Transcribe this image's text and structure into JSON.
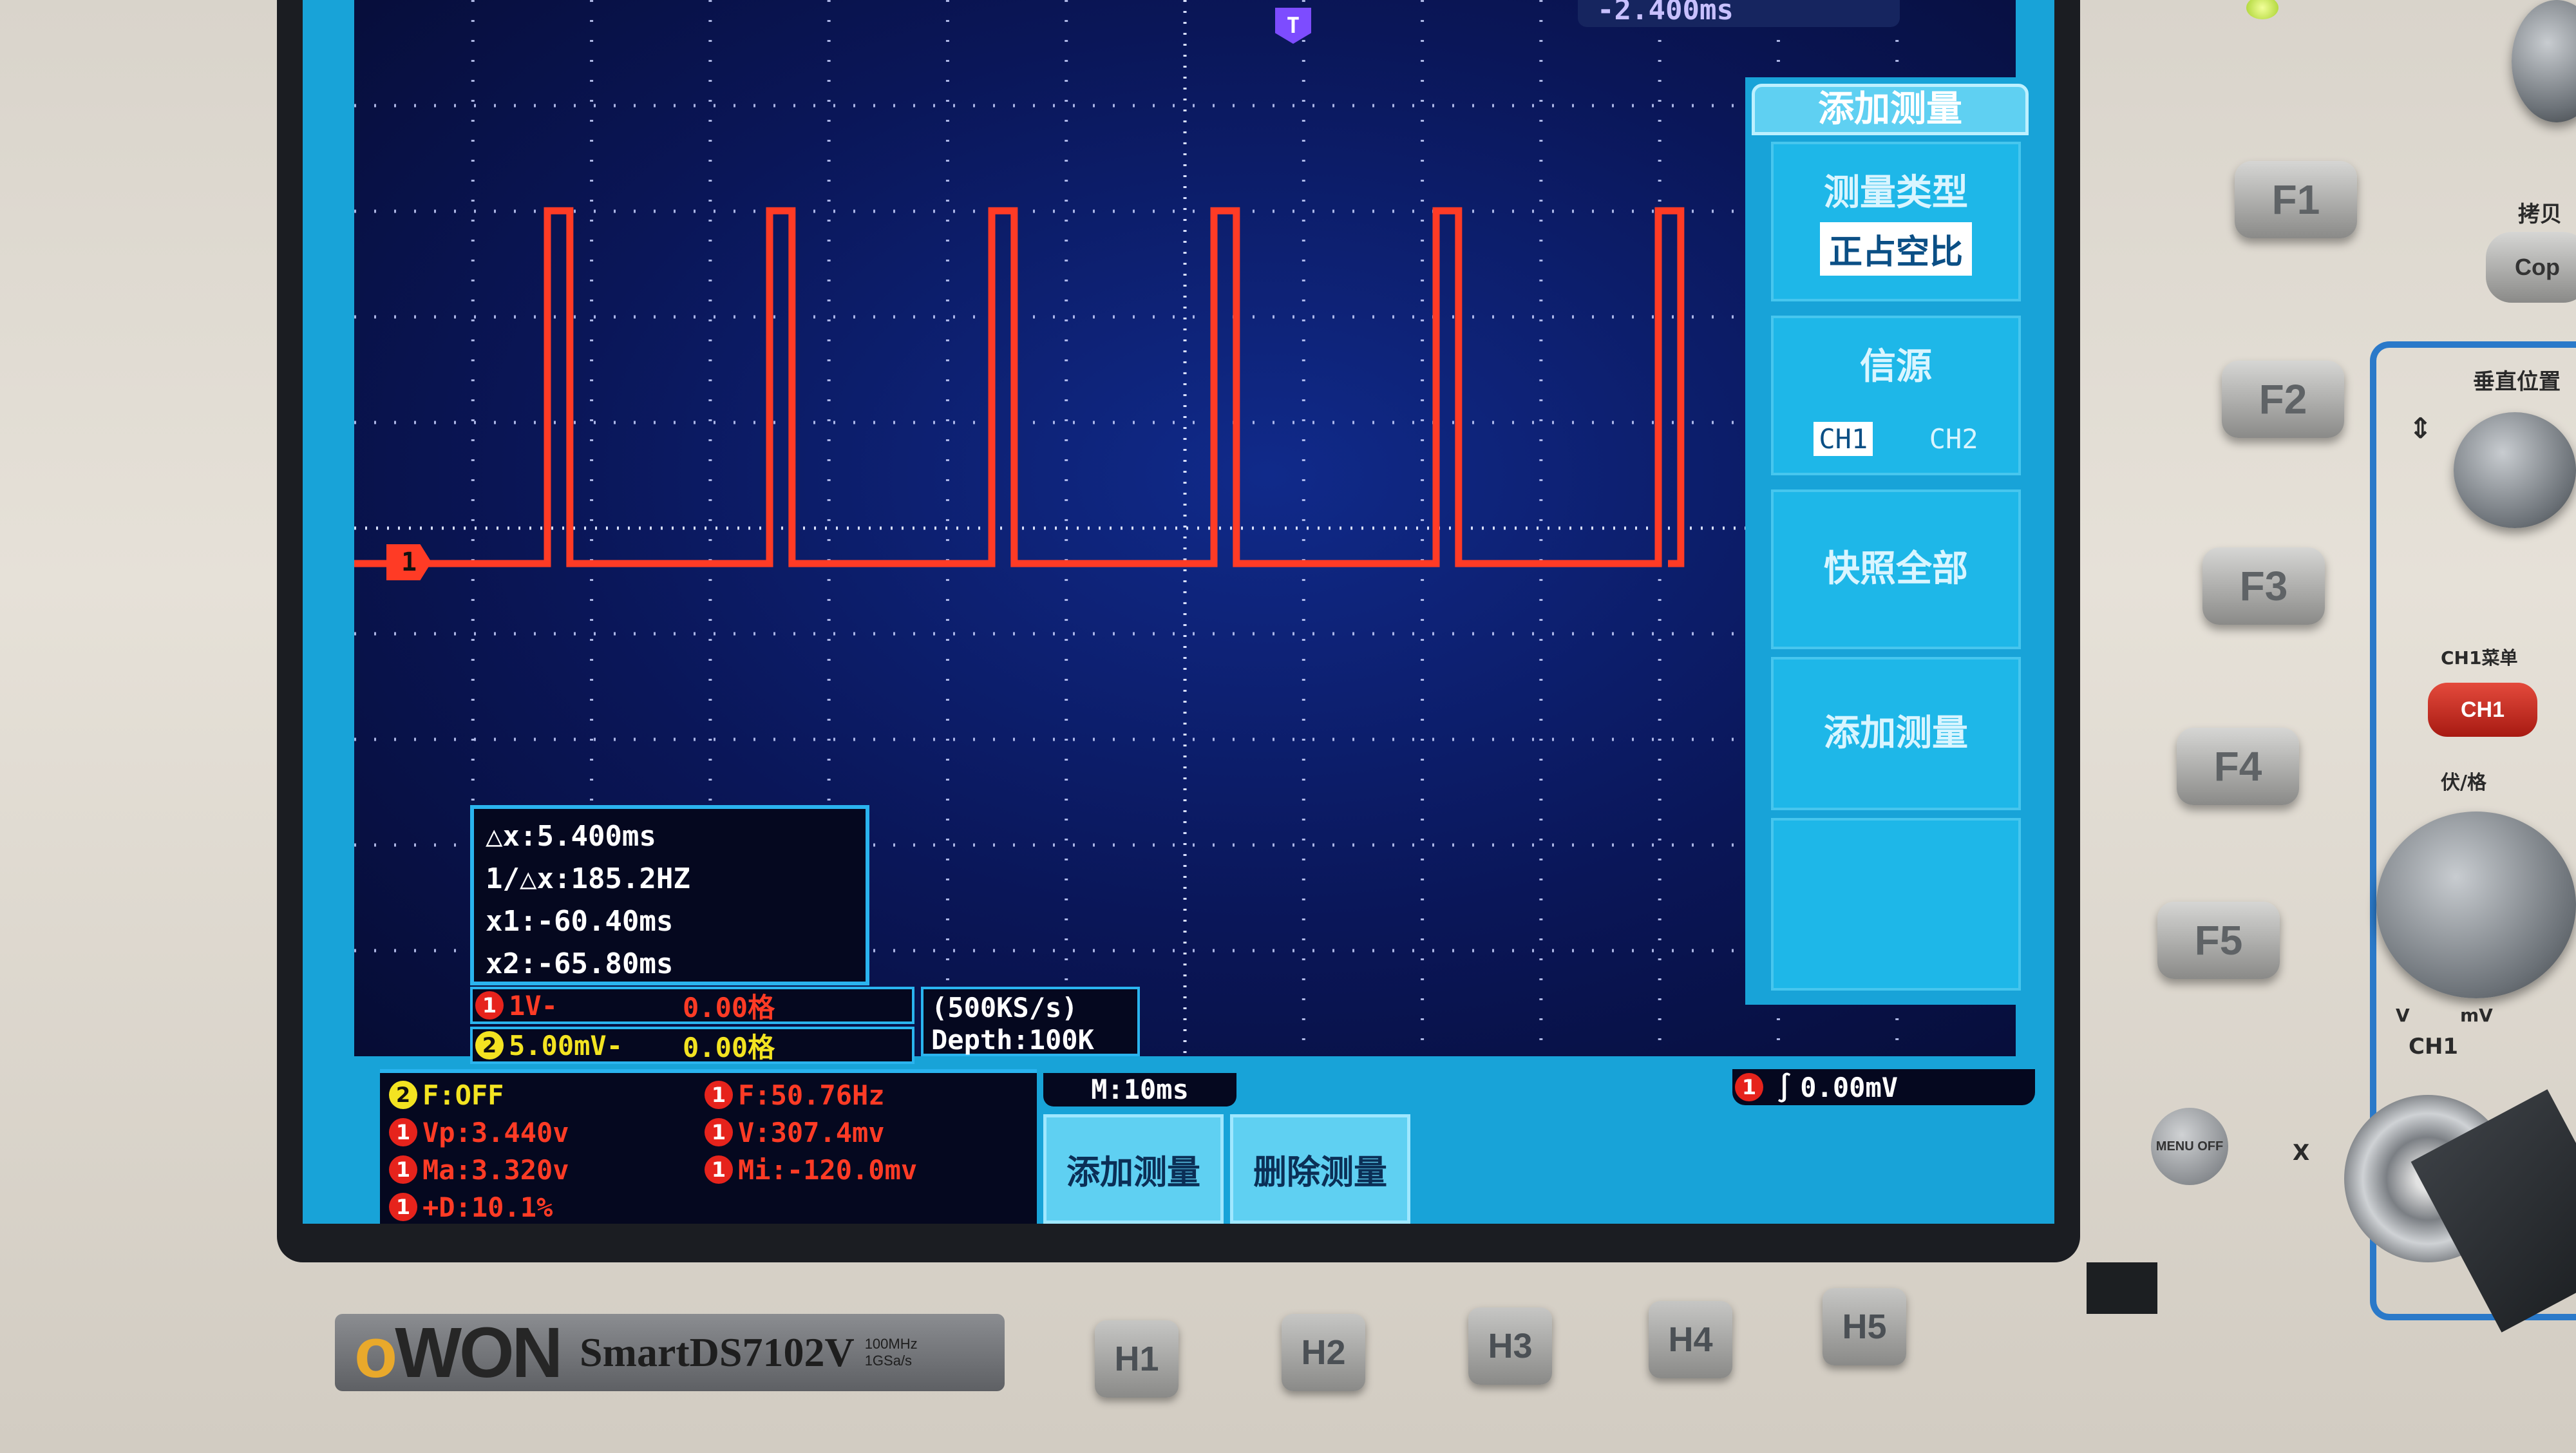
{
  "top_readout": "-2.400ms",
  "t_marker": "T",
  "ch1_marker": "1",
  "cursor": {
    "dx": "△x:5.400ms",
    "inv_dx": "1/△x:185.2HZ",
    "x1": "x1:-60.40ms",
    "x2": "x2:-65.80ms"
  },
  "channels": [
    {
      "num": "1",
      "scale": "1V-",
      "offset": "0.00格",
      "color": "#e6231c"
    },
    {
      "num": "2",
      "scale": "5.00mV-",
      "offset": "0.00格",
      "color": "#f3e321"
    }
  ],
  "sample": {
    "rate": "(500KS/s)",
    "depth": "Depth:100K"
  },
  "measurements": [
    {
      "ch": "2",
      "text": "F:OFF",
      "color": "#f3e321"
    },
    {
      "ch": "1",
      "text": "Vp:3.440v",
      "color": "#ff3b25"
    },
    {
      "ch": "1",
      "text": "Ma:3.320v",
      "color": "#ff3b25"
    },
    {
      "ch": "1",
      "text": "+D:10.1%",
      "color": "#ff3b25"
    },
    {
      "ch": "1",
      "text": "F:50.76Hz",
      "color": "#ff3b25"
    },
    {
      "ch": "1",
      "text": "V:307.4mv",
      "color": "#ff3b25"
    },
    {
      "ch": "1",
      "text": "Mi:-120.0mv",
      "color": "#ff3b25"
    }
  ],
  "timebase": "M:10ms",
  "trigger": {
    "ch": "1",
    "level": "0.00mV"
  },
  "bottom_buttons": [
    "添加测量",
    "删除测量"
  ],
  "menu": {
    "title": "添加测量",
    "type_label": "测量类型",
    "type_value": "正占空比",
    "source_label": "信源",
    "source_options": [
      "CH1",
      "CH2"
    ],
    "source_selected": "CH1",
    "snapshot": "快照全部",
    "add": "添加测量"
  },
  "f_buttons": [
    "F1",
    "F2",
    "F3",
    "F4",
    "F5"
  ],
  "h_buttons": [
    "H1",
    "H2",
    "H3",
    "H4",
    "H5"
  ],
  "brand": {
    "logo_a": "o",
    "logo_b": "WON",
    "model": "SmartDS7102V",
    "spec1": "100MHz",
    "spec2": "1GSa/s"
  },
  "panel": {
    "copy_label": "拷贝",
    "copy_btn": "Cop",
    "vpos_label": "垂直位置",
    "ch1_menu": "CH1菜单",
    "ch1_btn": "CH1",
    "vdiv_label": "伏/格",
    "v_unit": "V",
    "mv_unit": "mV",
    "ch1_label": "CH1",
    "x_label": "X",
    "menu_off": "MENU OFF"
  },
  "waveform": {
    "pulse_high_v": 3.32,
    "low_v": 0.0,
    "duty_percent": 10.1,
    "frequency_hz": 50.76,
    "pulse_count": 6
  },
  "colors": {
    "trace": "#ff3b25",
    "screen_bg": "#0a1658",
    "ui_blue": "#18a3d8"
  }
}
